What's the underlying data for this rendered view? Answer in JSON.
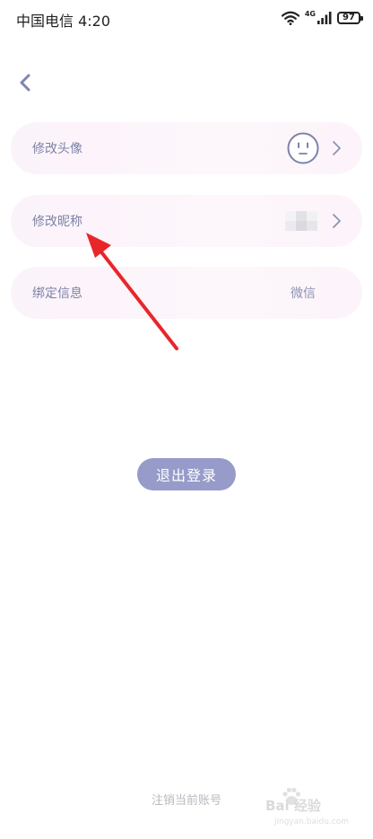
{
  "status_bar": {
    "carrier_time": "中国电信 4:20",
    "network": "4G",
    "battery": "97"
  },
  "rows": {
    "avatar": {
      "label": "修改头像"
    },
    "nickname": {
      "label": "修改昵称"
    },
    "binding": {
      "label": "绑定信息",
      "value": "微信"
    }
  },
  "logout_label": "退出登录",
  "cancel_account_label": "注销当前账号",
  "watermark": {
    "brand": "Bai 经验",
    "url": "jingyan.baidu.com"
  },
  "colors": {
    "accent": "#979bc9",
    "row_bg": "#fcf4fa",
    "label": "#7d82a8",
    "annotation": "#e8262a"
  }
}
